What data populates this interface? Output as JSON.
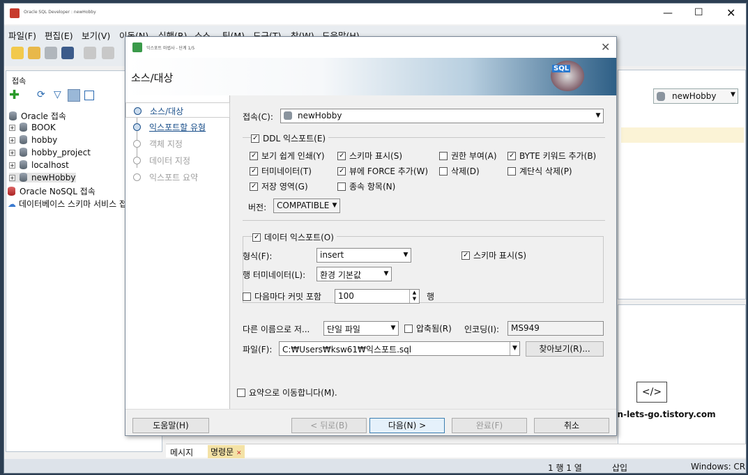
{
  "app": {
    "title": "Oracle SQL Developer : newHobby"
  },
  "menu": [
    "파일(F)",
    "편집(E)",
    "보기(V)",
    "이동(N)",
    "실행(R)",
    "소스",
    "팀(M)",
    "도구(T)",
    "창(W)",
    "도움말(H)"
  ],
  "connections": {
    "title": "접속",
    "root": "Oracle 접속",
    "items": [
      "BOOK",
      "hobby",
      "hobby_project",
      "localhost",
      "newHobby"
    ],
    "nosql": "Oracle NoSQL 접속",
    "schema": "데이터베이스 스키마 서비스 접"
  },
  "right_combo": "newHobby",
  "dialog": {
    "title": "익스포트 마법사 - 단계 1/5",
    "heading": "소스/대상",
    "steps": [
      "소스/대상",
      "익스포트할 유형",
      "객체 지정",
      "데이터 지정",
      "익스포트 요약"
    ],
    "connection_label": "접속(C):",
    "connection_value": "newHobby",
    "ddl_export": "DDL 익스포트(E)",
    "ddl_opts": [
      {
        "label": "보기 쉽게 인쇄(Y)",
        "on": true
      },
      {
        "label": "스키마 표시(S)",
        "on": true
      },
      {
        "label": "권한 부여(A)",
        "on": false
      },
      {
        "label": "BYTE 키워드 추가(B)",
        "on": true
      },
      {
        "label": "터미네이터(T)",
        "on": true
      },
      {
        "label": "뷰에 FORCE 추가(W)",
        "on": true
      },
      {
        "label": "삭제(D)",
        "on": false
      },
      {
        "label": "계단식 삭제(P)",
        "on": false
      },
      {
        "label": "저장 영역(G)",
        "on": true
      },
      {
        "label": "종속 항목(N)",
        "on": false
      }
    ],
    "version_label": "버전:",
    "version_value": "COMPATIBLE",
    "data_export": "데이터 익스포트(O)",
    "format_label": "형식(F):",
    "format_value": "insert",
    "show_schema": "스키마 표시(S)",
    "row_term_label": "행 터미네이터(L):",
    "row_term_value": "환경 기본값",
    "commit_label": "다음마다 커밋 포함",
    "commit_value": "100",
    "commit_unit": "행",
    "save_as_label": "다른 이름으로 저...",
    "save_as_value": "단일 파일",
    "compress": "압축됨(R)",
    "encoding_label": "인코딩(I):",
    "encoding_value": "MS949",
    "file_label": "파일(F):",
    "file_value": "C:₩Users₩ksw61₩익스포트.sql",
    "browse": "찾아보기(R)...",
    "go_summary": "요약으로 이동합니다(M).",
    "buttons": {
      "help": "도움말(H)",
      "back": "< 뒤로(B)",
      "next": "다음(N) >",
      "finish": "완료(F)",
      "cancel": "취소"
    }
  },
  "bottom_tabs": [
    "메시지",
    "명령문"
  ],
  "watermark": "http://sean-lets-go.tistory.com",
  "status": {
    "row_col": "1 행 1 열",
    "insert": "삽입",
    "eol": "Windows: CR"
  },
  "colors": {
    "accent": "#1a4f8a",
    "banner": "#2e5f86"
  }
}
